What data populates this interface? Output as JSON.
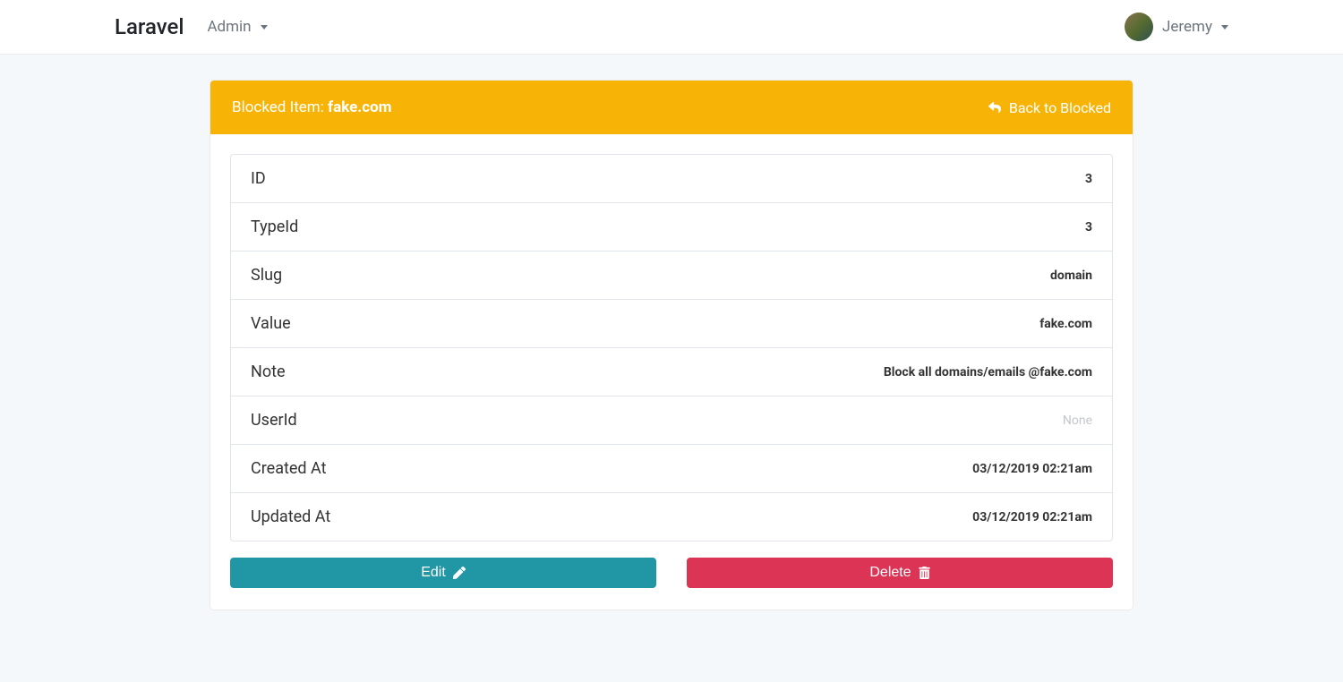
{
  "navbar": {
    "brand": "Laravel",
    "admin_label": "Admin",
    "user_name": "Jeremy"
  },
  "header": {
    "title_prefix": "Blocked Item: ",
    "title_value": "fake.com",
    "back_label": "Back to Blocked"
  },
  "details": [
    {
      "label": "ID",
      "value": "3",
      "muted": false
    },
    {
      "label": "TypeId",
      "value": "3",
      "muted": false
    },
    {
      "label": "Slug",
      "value": "domain",
      "muted": false
    },
    {
      "label": "Value",
      "value": "fake.com",
      "muted": false
    },
    {
      "label": "Note",
      "value": "Block all domains/emails @fake.com",
      "muted": false
    },
    {
      "label": "UserId",
      "value": "None",
      "muted": true
    },
    {
      "label": "Created At",
      "value": "03/12/2019 02:21am",
      "muted": false
    },
    {
      "label": "Updated At",
      "value": "03/12/2019 02:21am",
      "muted": false
    }
  ],
  "actions": {
    "edit_label": "Edit",
    "delete_label": "Delete"
  }
}
